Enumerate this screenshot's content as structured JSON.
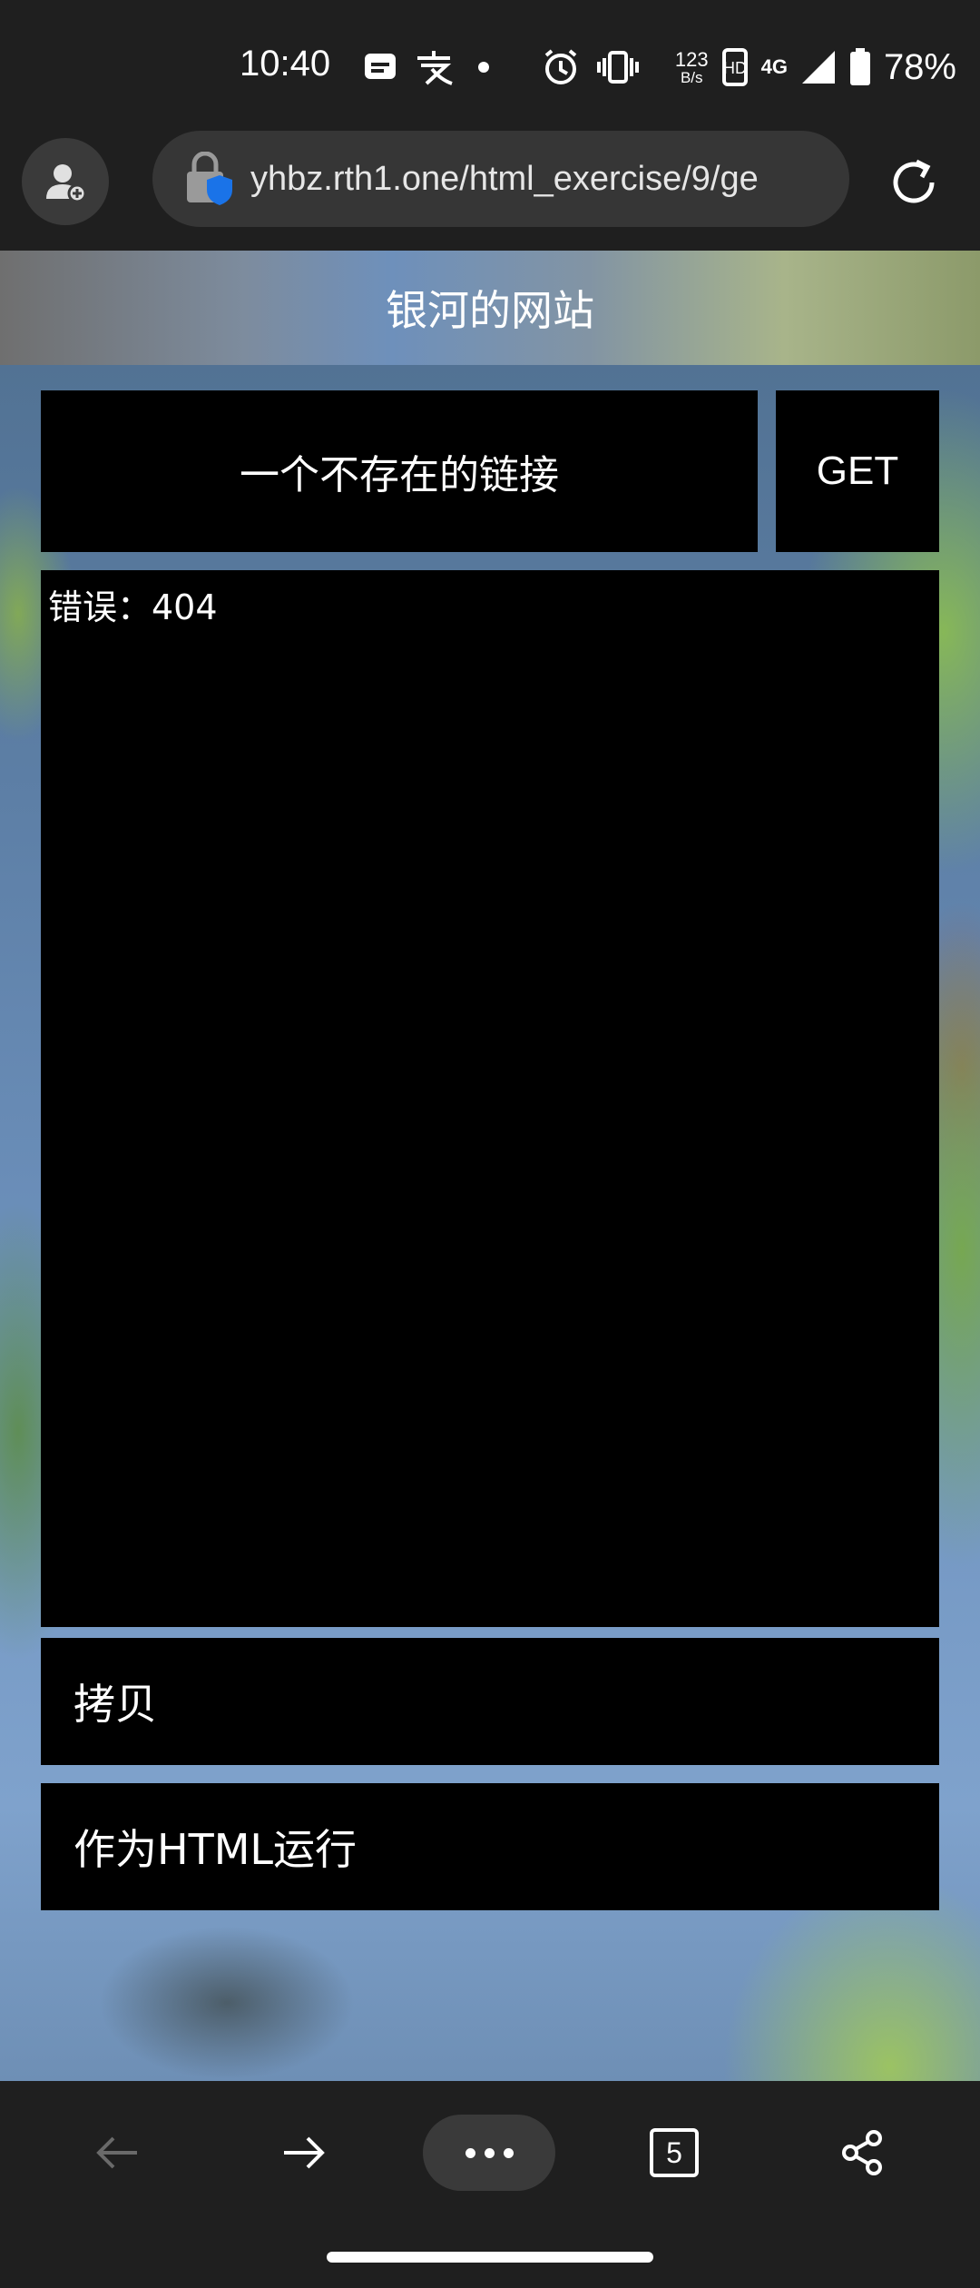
{
  "status_bar": {
    "time": "10:40",
    "net_speed_value": "123",
    "net_speed_unit": "B/s",
    "network_type": "4G",
    "battery": "78%",
    "icons": [
      "message-icon",
      "alipay-icon",
      "dot-icon",
      "alarm-icon",
      "vibrate-icon",
      "volte-icon",
      "signal-icon",
      "battery-icon"
    ]
  },
  "browser": {
    "url": "yhbz.rth1.one/html_exercise/9/ge",
    "icons": [
      "profile-icon",
      "lock-shield-icon",
      "reload-icon"
    ]
  },
  "page": {
    "site_title": "银河的网站",
    "url_input_value": "一个不存在的链接",
    "get_label": "GET",
    "output_text": "错误：404",
    "copy_label": "拷贝",
    "run_label": "作为HTML运行"
  },
  "toolbar": {
    "tab_count": "5",
    "icons": [
      "back-arrow-icon",
      "forward-arrow-icon",
      "more-icon",
      "tabs-icon",
      "share-icon"
    ]
  }
}
